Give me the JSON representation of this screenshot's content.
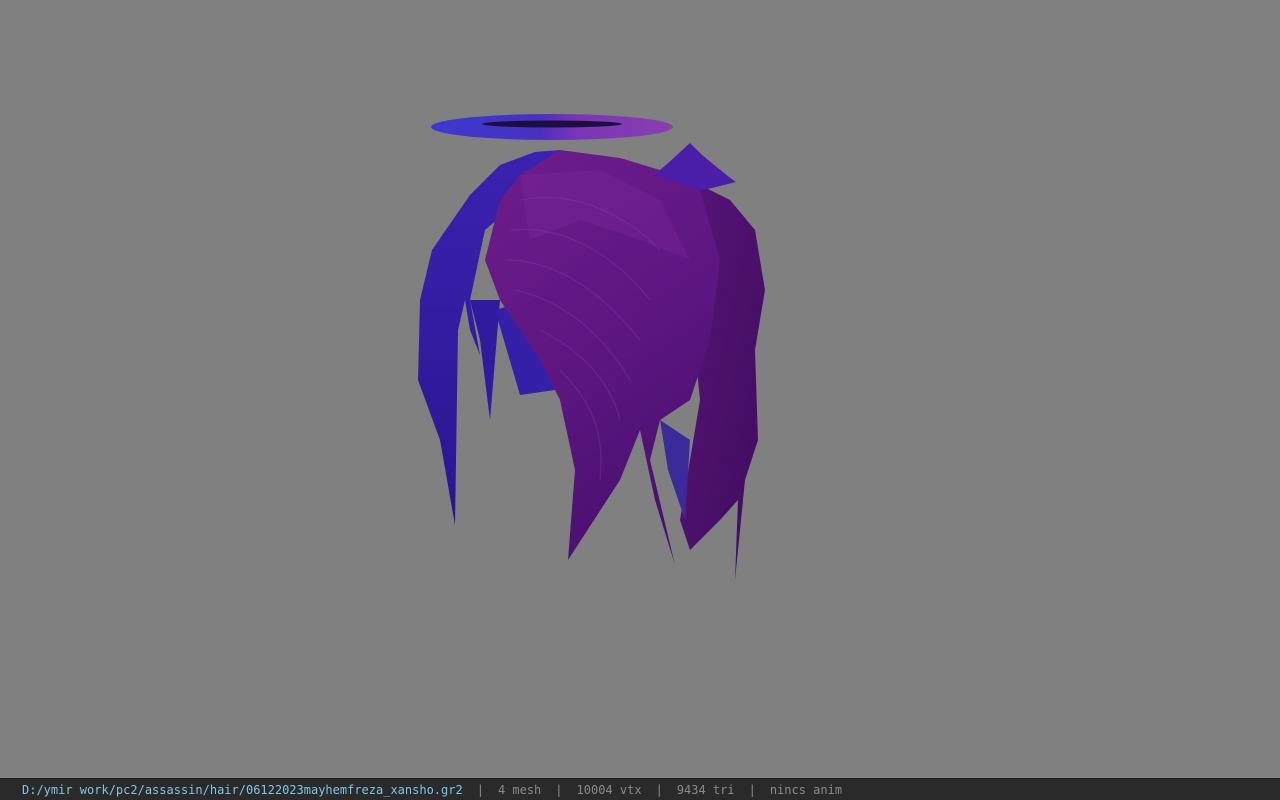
{
  "status_bar": {
    "file_path": "D:/ymir work/pc2/assassin/hair/06122023mayhemfreza_xansho.gr2",
    "mesh_count": "4 mesh",
    "vertex_count": "10004 vtx",
    "triangle_count": "9434 tri",
    "anim_status": "nincs anim",
    "separator": "|"
  },
  "colors": {
    "background": "#808080",
    "status_bar_bg": "#2a2a2a",
    "path_text": "#7fc6e6",
    "stat_text": "#8a8a8a",
    "hair_purple": "#6a1f8a",
    "hair_blue": "#3a1fa0",
    "halo": "#5a2fc8"
  }
}
